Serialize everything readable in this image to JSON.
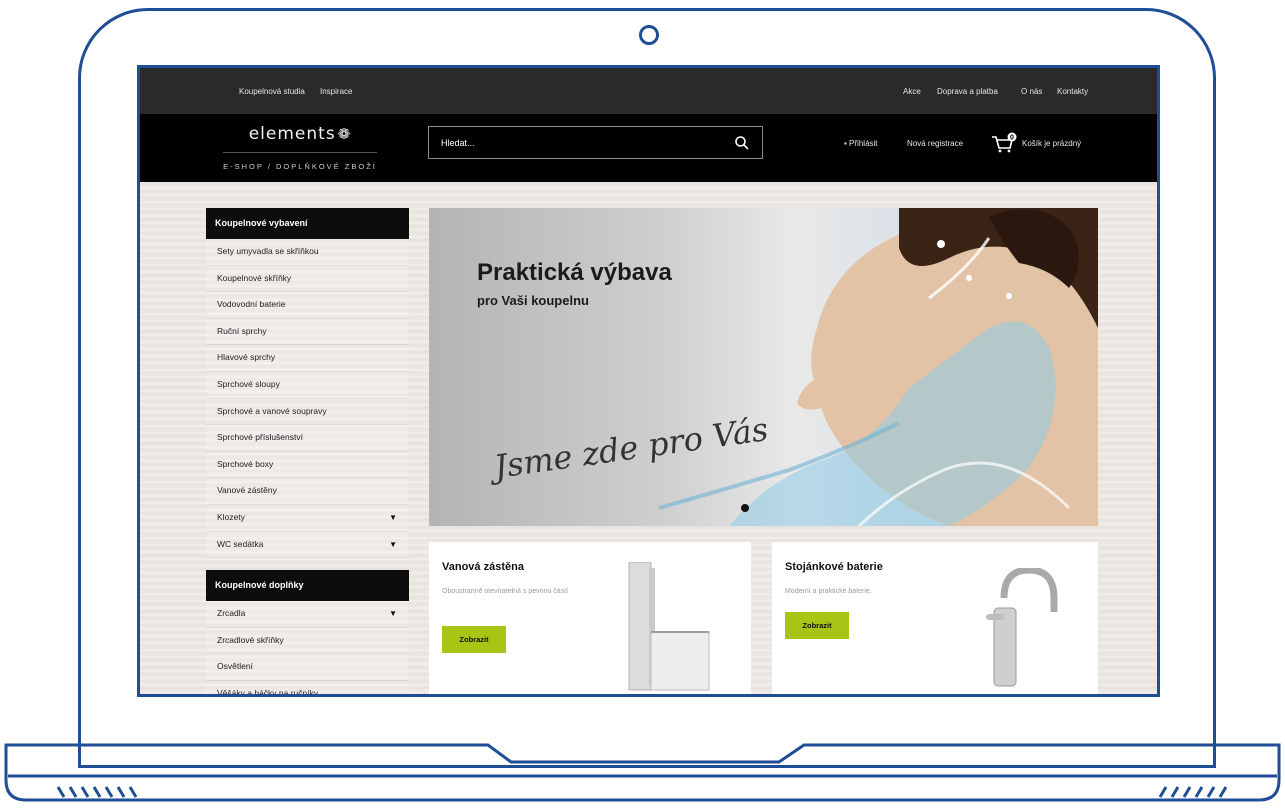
{
  "topbar": {
    "left_links": [
      "Koupelnová studia",
      "Inspirace"
    ],
    "right_links": [
      "Akce",
      "Doprava a platba",
      "O nás",
      "Kontakty"
    ]
  },
  "header": {
    "logo_word": "elements",
    "logo_sub": "E-SHOP / DOPLŇKOVÉ ZBOŽÍ",
    "search_placeholder": "Hledat...",
    "login": "▪ Přihlásit",
    "register": "Nová registrace",
    "cart_count": "0",
    "cart": "Košík je prázdný"
  },
  "sidebar": {
    "groups": [
      {
        "title": "Koupelnové vybavení",
        "items": [
          {
            "label": "Sety umyvadla se skříňkou"
          },
          {
            "label": "Koupelnové skříňky"
          },
          {
            "label": "Vodovodní baterie"
          },
          {
            "label": "Ruční sprchy"
          },
          {
            "label": "Hlavové sprchy"
          },
          {
            "label": "Sprchové sloupy"
          },
          {
            "label": "Sprchové a vanové soupravy"
          },
          {
            "label": "Sprchové příslušenství"
          },
          {
            "label": "Sprchové boxy"
          },
          {
            "label": "Vanové zástěny"
          },
          {
            "label": "Klozety",
            "caret": "▼"
          },
          {
            "label": "WC sedátka",
            "caret": "▼"
          }
        ]
      },
      {
        "title": "Koupelnové doplňky",
        "items": [
          {
            "label": "Zrcadla",
            "caret": "▼"
          },
          {
            "label": "Zrcadlové skříňky"
          },
          {
            "label": "Osvětlení"
          },
          {
            "label": "Věšáky a háčky na ručníky"
          }
        ]
      }
    ]
  },
  "hero": {
    "title": "Praktická výbava",
    "subtitle": "pro Vaši koupelnu",
    "script": "Jsme zde pro Vás"
  },
  "cards": [
    {
      "title": "Vanová zástěna",
      "desc": "Oboustranně otevíratelná s pevnou částí",
      "button": "Zobrazit"
    },
    {
      "title": "Stojánkové baterie",
      "desc": "Moderní a praktické baterie.",
      "button": "Zobrazit"
    }
  ],
  "colors": {
    "frame": "#1f4e96",
    "accent": "#a8c516",
    "header_bg": "#000000",
    "topbar_bg": "#2a2a2a"
  }
}
